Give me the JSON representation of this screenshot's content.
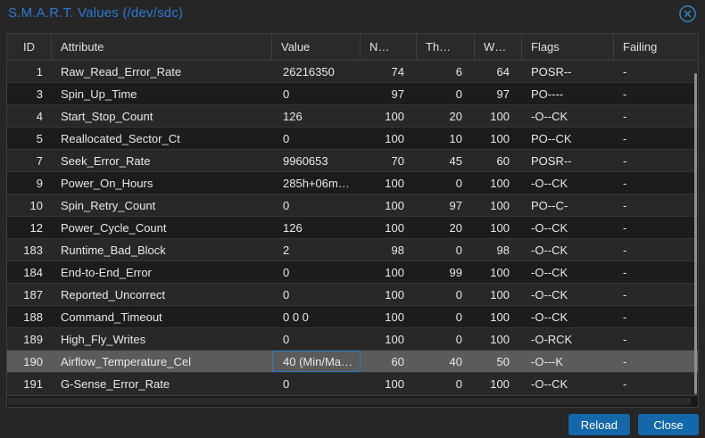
{
  "dialog": {
    "title": "S.M.A.R.T. Values (/dev/sdc)"
  },
  "table": {
    "columns": [
      {
        "key": "id",
        "label": "ID"
      },
      {
        "key": "attribute",
        "label": "Attribute"
      },
      {
        "key": "value",
        "label": "Value"
      },
      {
        "key": "normalized",
        "label": "N…"
      },
      {
        "key": "threshold",
        "label": "Th…"
      },
      {
        "key": "worst",
        "label": "W…"
      },
      {
        "key": "flags",
        "label": "Flags"
      },
      {
        "key": "failing",
        "label": "Failing"
      }
    ],
    "rows": [
      {
        "id": "1",
        "attribute": "Raw_Read_Error_Rate",
        "value": "26216350",
        "normalized": "74",
        "threshold": "6",
        "worst": "64",
        "flags": "POSR--",
        "failing": "-"
      },
      {
        "id": "3",
        "attribute": "Spin_Up_Time",
        "value": "0",
        "normalized": "97",
        "threshold": "0",
        "worst": "97",
        "flags": "PO----",
        "failing": "-"
      },
      {
        "id": "4",
        "attribute": "Start_Stop_Count",
        "value": "126",
        "normalized": "100",
        "threshold": "20",
        "worst": "100",
        "flags": "-O--CK",
        "failing": "-"
      },
      {
        "id": "5",
        "attribute": "Reallocated_Sector_Ct",
        "value": "0",
        "normalized": "100",
        "threshold": "10",
        "worst": "100",
        "flags": "PO--CK",
        "failing": "-"
      },
      {
        "id": "7",
        "attribute": "Seek_Error_Rate",
        "value": "9960653",
        "normalized": "70",
        "threshold": "45",
        "worst": "60",
        "flags": "POSR--",
        "failing": "-"
      },
      {
        "id": "9",
        "attribute": "Power_On_Hours",
        "value": "285h+06m…",
        "normalized": "100",
        "threshold": "0",
        "worst": "100",
        "flags": "-O--CK",
        "failing": "-"
      },
      {
        "id": "10",
        "attribute": "Spin_Retry_Count",
        "value": "0",
        "normalized": "100",
        "threshold": "97",
        "worst": "100",
        "flags": "PO--C-",
        "failing": "-"
      },
      {
        "id": "12",
        "attribute": "Power_Cycle_Count",
        "value": "126",
        "normalized": "100",
        "threshold": "20",
        "worst": "100",
        "flags": "-O--CK",
        "failing": "-"
      },
      {
        "id": "183",
        "attribute": "Runtime_Bad_Block",
        "value": "2",
        "normalized": "98",
        "threshold": "0",
        "worst": "98",
        "flags": "-O--CK",
        "failing": "-"
      },
      {
        "id": "184",
        "attribute": "End-to-End_Error",
        "value": "0",
        "normalized": "100",
        "threshold": "99",
        "worst": "100",
        "flags": "-O--CK",
        "failing": "-"
      },
      {
        "id": "187",
        "attribute": "Reported_Uncorrect",
        "value": "0",
        "normalized": "100",
        "threshold": "0",
        "worst": "100",
        "flags": "-O--CK",
        "failing": "-"
      },
      {
        "id": "188",
        "attribute": "Command_Timeout",
        "value": "0 0 0",
        "normalized": "100",
        "threshold": "0",
        "worst": "100",
        "flags": "-O--CK",
        "failing": "-"
      },
      {
        "id": "189",
        "attribute": "High_Fly_Writes",
        "value": "0",
        "normalized": "100",
        "threshold": "0",
        "worst": "100",
        "flags": "-O-RCK",
        "failing": "-"
      },
      {
        "id": "190",
        "attribute": "Airflow_Temperature_Cel",
        "value": "40 (Min/Ma…",
        "normalized": "60",
        "threshold": "40",
        "worst": "50",
        "flags": "-O---K",
        "failing": "-",
        "selected": true
      },
      {
        "id": "191",
        "attribute": "G-Sense_Error_Rate",
        "value": "0",
        "normalized": "100",
        "threshold": "0",
        "worst": "100",
        "flags": "-O--CK",
        "failing": "-"
      }
    ]
  },
  "buttons": {
    "reload": "Reload",
    "close": "Close"
  },
  "icons": {
    "close": "circled-x"
  },
  "colors": {
    "title_text": "#2c77d4",
    "close_icon": "#2e84bb",
    "button_bg": "#1467a9",
    "selected_row_bg": "#5b5b5b",
    "focused_cell_border": "#2d7cc4",
    "row_light": "#282828",
    "row_dark": "#1c1c1c",
    "grid_line": "#3e3e3e",
    "scrollbar_thumb": "#8f8f8f"
  }
}
